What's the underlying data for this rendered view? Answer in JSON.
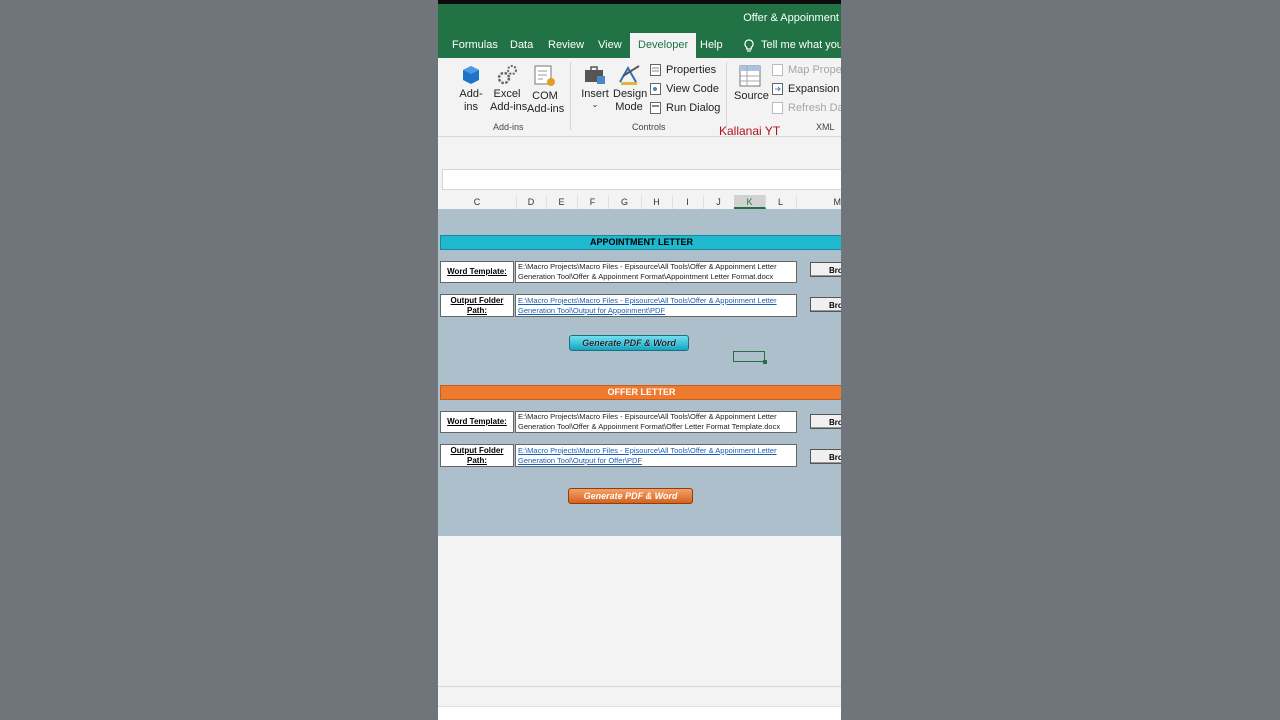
{
  "window": {
    "title": "Offer & Appoinment"
  },
  "tabs": [
    {
      "label": "Formulas"
    },
    {
      "label": "Data"
    },
    {
      "label": "Review"
    },
    {
      "label": "View"
    },
    {
      "label": "Developer"
    },
    {
      "label": "Help"
    }
  ],
  "tell_me": "Tell me what you",
  "ribbon": {
    "addins": {
      "addins_label": "Add-\nins",
      "excel_addins_label": "Excel\nAdd-ins",
      "com_addins_label": "COM\nAdd-ins",
      "group": "Add-ins"
    },
    "controls": {
      "insert_label": "Insert",
      "design_mode_label": "Design\nMode",
      "properties_label": "Properties",
      "view_code_label": "View Code",
      "run_dialog_label": "Run Dialog",
      "group": "Controls"
    },
    "xml": {
      "source_label": "Source",
      "map_properties_label": "Map Propert",
      "expansion_packs_label": "Expansion Pa",
      "refresh_data_label": "Refresh Data",
      "group": "XML"
    },
    "watermark": "Kallanai YT"
  },
  "columns": [
    "C",
    "D",
    "E",
    "F",
    "G",
    "H",
    "I",
    "J",
    "K",
    "L",
    "M"
  ],
  "appointment": {
    "banner": "APPOINTMENT LETTER",
    "word_template_label": "Word Template:",
    "word_template_value": "E:\\Macro Projects\\Macro Files - Episource\\All Tools\\Offer & Appoinment Letter Generation Tool\\Offer & Appoinment Format\\Appointment Letter Format.docx",
    "output_folder_label": "Output Folder Path:",
    "output_folder_value": "E:\\Macro Projects\\Macro Files - Episource\\All Tools\\Offer & Appoinment Letter Generation Tool\\Output for Appoinment\\PDF",
    "browse_label": "Bro",
    "generate_label": "Generate PDF & Word"
  },
  "offer": {
    "banner": "OFFER LETTER",
    "word_template_label": "Word Template:",
    "word_template_value": "E:\\Macro Projects\\Macro Files - Episource\\All Tools\\Offer & Appoinment Letter Generation Tool\\Offer & Appoinment Format\\Offer Letter Format Template.docx",
    "output_folder_label": "Output Folder Path:",
    "output_folder_value": "E:\\Macro Projects\\Macro Files - Episource\\All Tools\\Offer & Appoinment Letter Generation Tool\\Output for Offer\\PDF",
    "browse_label": "Bro",
    "generate_label": "Generate PDF & Word"
  },
  "colors": {
    "excel_green": "#217346",
    "appointment_banner": "#1fb8cf",
    "offer_banner": "#ee7a2f",
    "sheet_bg": "#adbfca",
    "watermark": "#b0141a"
  },
  "icons": [
    "addins-icon",
    "excel-addins-icon",
    "com-addins-icon",
    "insert-icon",
    "design-mode-icon",
    "properties-icon",
    "view-code-icon",
    "run-dialog-icon",
    "source-icon",
    "map-properties-icon",
    "expansion-packs-icon",
    "refresh-data-icon",
    "lightbulb-icon"
  ]
}
